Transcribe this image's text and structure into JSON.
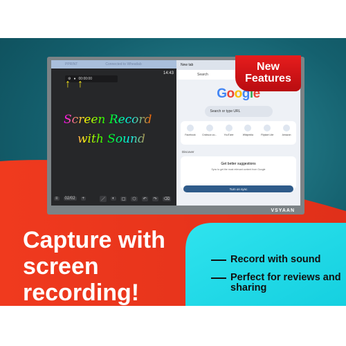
{
  "badge": "New Features",
  "headline": [
    "Capture with",
    "screen",
    "recording!"
  ],
  "bullets": [
    "Record with sound",
    "Perfect for reviews and sharing"
  ],
  "brand": "VSYAAN",
  "whiteboard": {
    "clock": "14:43",
    "timer": "00:00:00",
    "drawing": [
      "Screen Record",
      "with Sound"
    ],
    "page": "02/02",
    "topbar": [
      "PPRINT",
      "Connected to Wheatlab"
    ]
  },
  "browser": {
    "tab": "New tab",
    "address": "Search",
    "logo": "Google",
    "search_placeholder": "Search or type URL",
    "shortcuts": [
      "Facebook",
      "Cricbuzz.co...",
      "YouTube",
      "Wikipedia",
      "Flipkart Lite",
      "Amazon"
    ],
    "discover": "Discover",
    "card_title": "Get better suggestions",
    "card_text": "Sync to get the most relevant content from Google",
    "sync_button": "Turn on sync"
  }
}
